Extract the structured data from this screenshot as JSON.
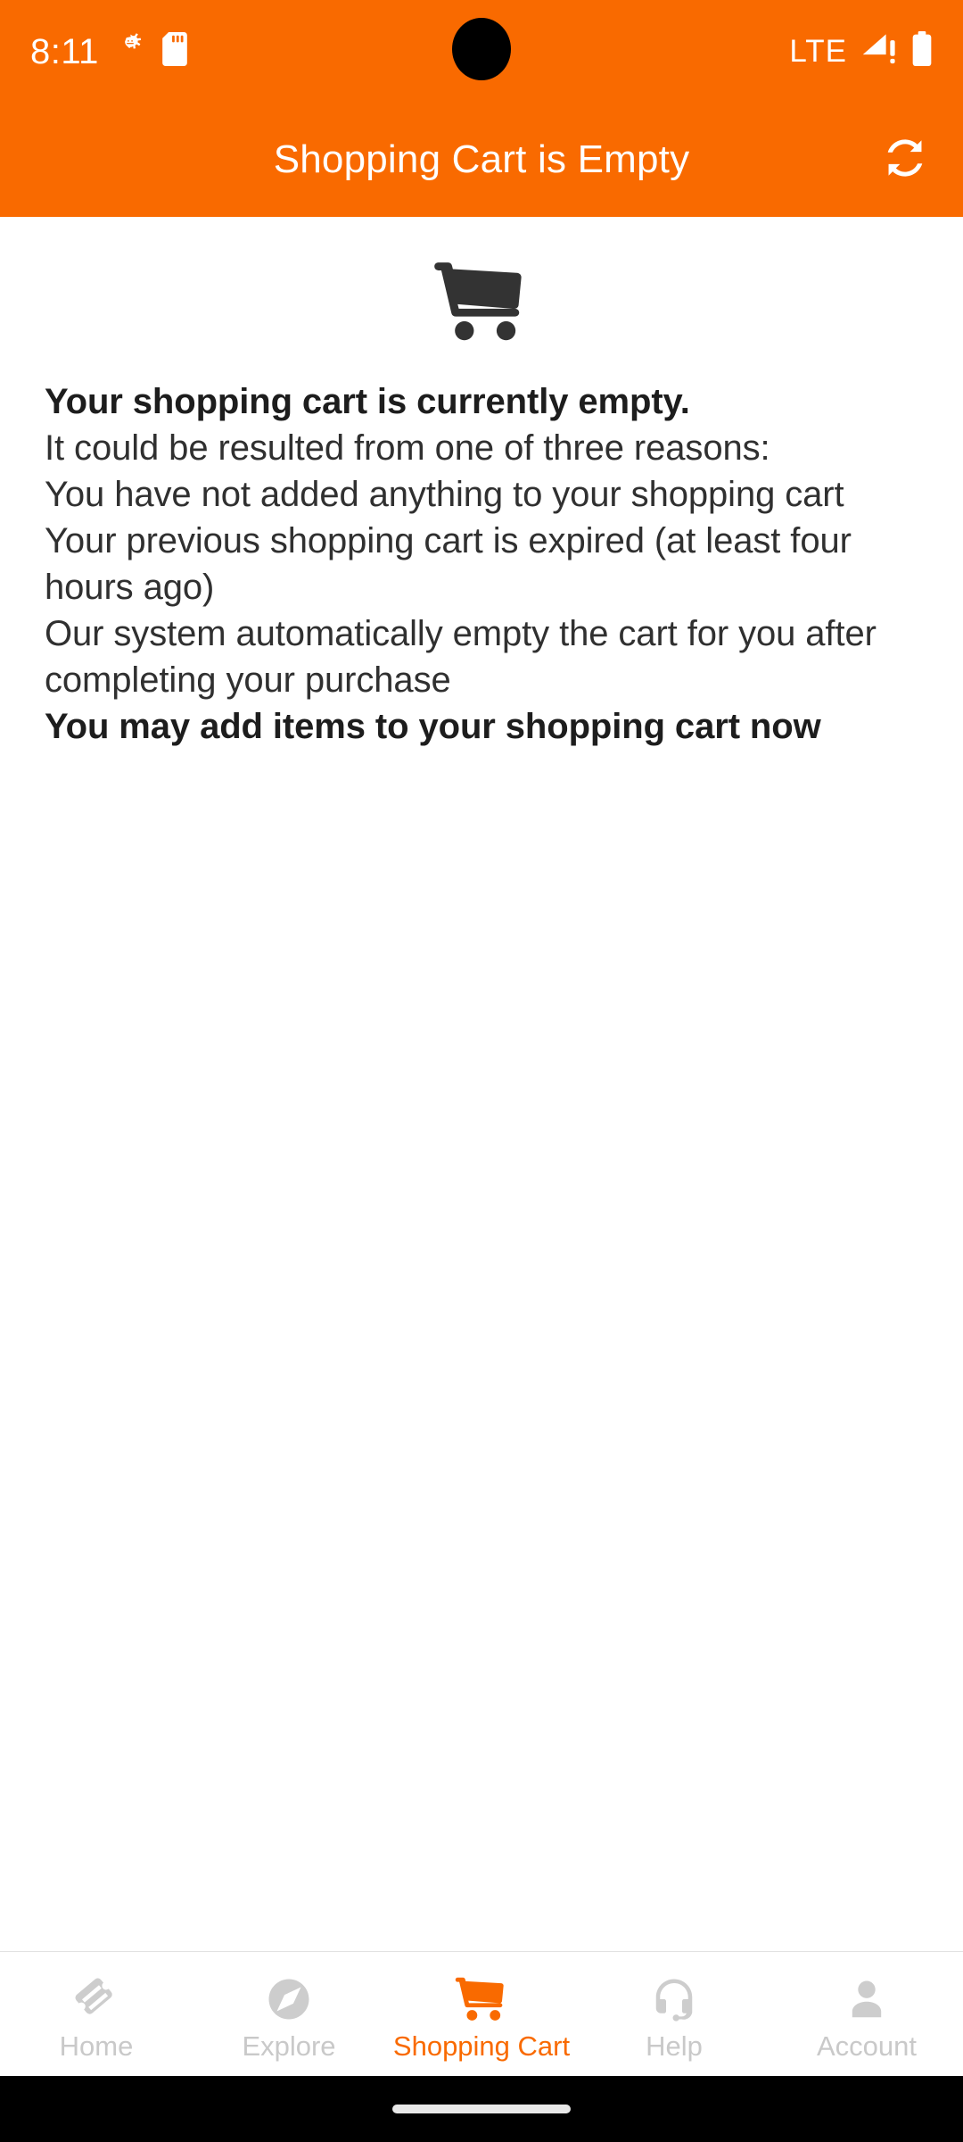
{
  "theme": {
    "accent": "#F96A00",
    "text_primary": "#303030",
    "nav_inactive": "#c9c9c9",
    "cart_glyph": "#333333",
    "background": "#FFFFFF"
  },
  "status_bar": {
    "time": "8:11",
    "network_label": "LTE",
    "icons": [
      "android-debug-icon",
      "sd-card-icon",
      "signal-no-service-icon",
      "battery-full-icon"
    ]
  },
  "app_bar": {
    "title": "Shopping Cart is Empty",
    "action_icon": "refresh-sync-icon"
  },
  "main": {
    "hero_icon": "shopping-cart-icon",
    "heading": "Your shopping cart is currently empty.",
    "intro": "It could be resulted from one of three reasons:",
    "reasons": [
      "You have not added anything to your shopping cart",
      "Your previous shopping cart is expired (at least four hours ago)",
      "Our system automatically empty the cart for you after completing your purchase"
    ],
    "call_to_action": "You may add items to your shopping cart now"
  },
  "bottom_nav": {
    "active_index": 2,
    "items": [
      {
        "label": "Home",
        "icon": "ticket-icon"
      },
      {
        "label": "Explore",
        "icon": "explore-compass-icon"
      },
      {
        "label": "Shopping Cart",
        "icon": "shopping-cart-icon"
      },
      {
        "label": "Help",
        "icon": "headset-support-icon"
      },
      {
        "label": "Account",
        "icon": "person-account-icon"
      }
    ]
  }
}
